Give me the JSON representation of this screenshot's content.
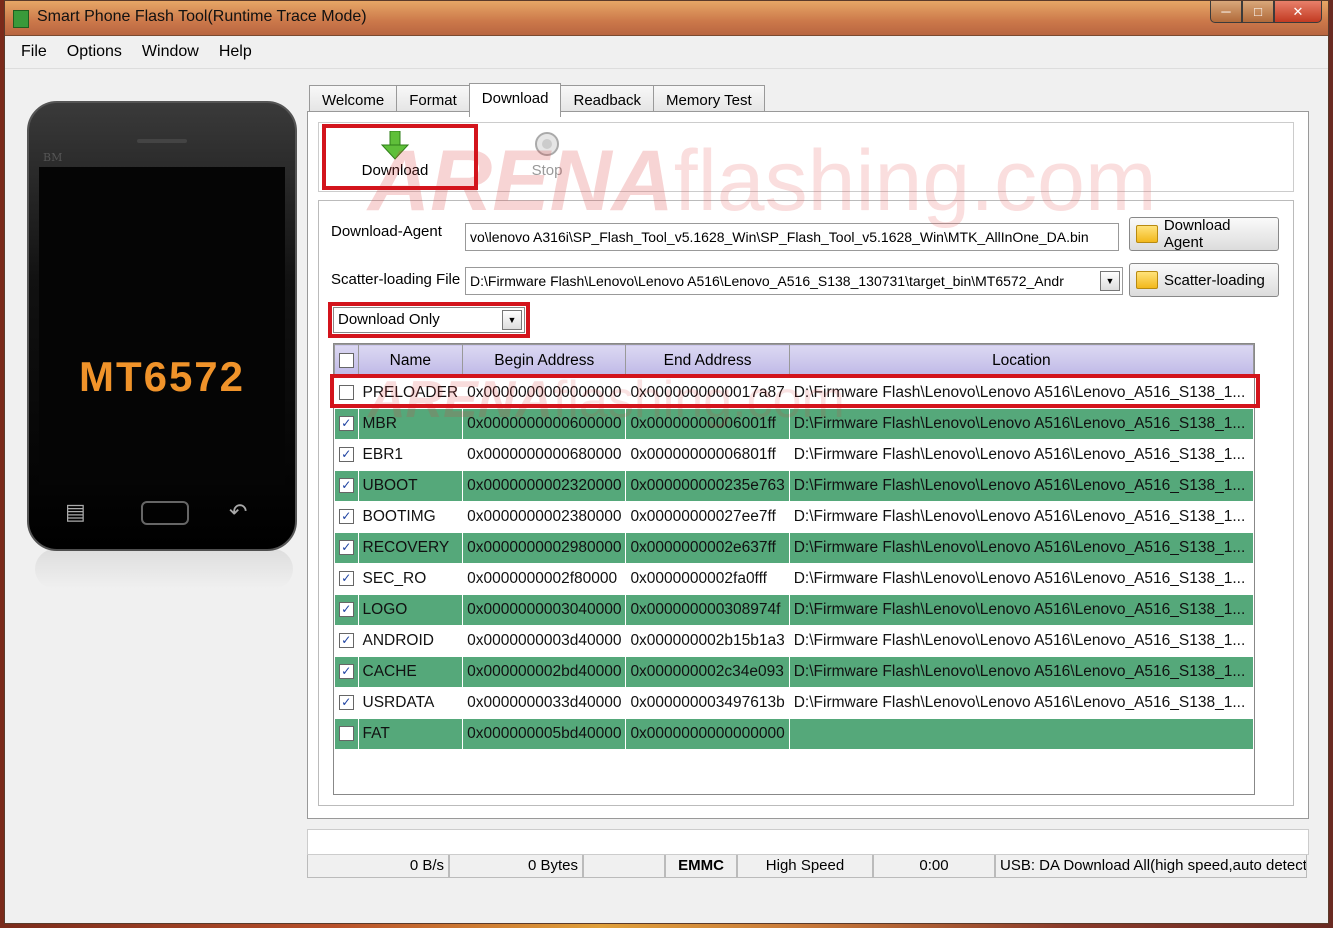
{
  "window": {
    "title": "Smart Phone Flash Tool(Runtime Trace Mode)"
  },
  "menu": [
    "File",
    "Options",
    "Window",
    "Help"
  ],
  "phone": {
    "model": "MT6572",
    "brand": "BM"
  },
  "tabs": [
    "Welcome",
    "Format",
    "Download",
    "Readback",
    "Memory Test"
  ],
  "active_tab": "Download",
  "toolbar": {
    "download_label": "Download",
    "stop_label": "Stop"
  },
  "watermark": {
    "part1": "ARENA",
    "part2": "flashing.com"
  },
  "download_agent": {
    "label": "Download-Agent",
    "value": "vo\\lenovo A316i\\SP_Flash_Tool_v5.1628_Win\\SP_Flash_Tool_v5.1628_Win\\MTK_AllInOne_DA.bin",
    "button": "Download Agent"
  },
  "scatter": {
    "label": "Scatter-loading File",
    "value": "D:\\Firmware Flash\\Lenovo\\Lenovo A516\\Lenovo_A516_S138_130731\\target_bin\\MT6572_Andr",
    "button": "Scatter-loading"
  },
  "mode_select": {
    "value": "Download Only"
  },
  "table": {
    "headers": [
      "Name",
      "Begin Address",
      "End Address",
      "Location"
    ],
    "rows": [
      {
        "checked": false,
        "name": "PRELOADER",
        "begin": "0x0000000000000000",
        "end": "0x0000000000017a87",
        "location": "D:\\Firmware Flash\\Lenovo\\Lenovo A516\\Lenovo_A516_S138_1..."
      },
      {
        "checked": true,
        "name": "MBR",
        "begin": "0x0000000000600000",
        "end": "0x00000000006001ff",
        "location": "D:\\Firmware Flash\\Lenovo\\Lenovo A516\\Lenovo_A516_S138_1..."
      },
      {
        "checked": true,
        "name": "EBR1",
        "begin": "0x0000000000680000",
        "end": "0x00000000006801ff",
        "location": "D:\\Firmware Flash\\Lenovo\\Lenovo A516\\Lenovo_A516_S138_1..."
      },
      {
        "checked": true,
        "name": "UBOOT",
        "begin": "0x0000000002320000",
        "end": "0x000000000235e763",
        "location": "D:\\Firmware Flash\\Lenovo\\Lenovo A516\\Lenovo_A516_S138_1..."
      },
      {
        "checked": true,
        "name": "BOOTIMG",
        "begin": "0x0000000002380000",
        "end": "0x00000000027ee7ff",
        "location": "D:\\Firmware Flash\\Lenovo\\Lenovo A516\\Lenovo_A516_S138_1..."
      },
      {
        "checked": true,
        "name": "RECOVERY",
        "begin": "0x0000000002980000",
        "end": "0x0000000002e637ff",
        "location": "D:\\Firmware Flash\\Lenovo\\Lenovo A516\\Lenovo_A516_S138_1..."
      },
      {
        "checked": true,
        "name": "SEC_RO",
        "begin": "0x0000000002f80000",
        "end": "0x0000000002fa0fff",
        "location": "D:\\Firmware Flash\\Lenovo\\Lenovo A516\\Lenovo_A516_S138_1..."
      },
      {
        "checked": true,
        "name": "LOGO",
        "begin": "0x0000000003040000",
        "end": "0x000000000308974f",
        "location": "D:\\Firmware Flash\\Lenovo\\Lenovo A516\\Lenovo_A516_S138_1..."
      },
      {
        "checked": true,
        "name": "ANDROID",
        "begin": "0x0000000003d40000",
        "end": "0x000000002b15b1a3",
        "location": "D:\\Firmware Flash\\Lenovo\\Lenovo A516\\Lenovo_A516_S138_1..."
      },
      {
        "checked": true,
        "name": "CACHE",
        "begin": "0x000000002bd40000",
        "end": "0x000000002c34e093",
        "location": "D:\\Firmware Flash\\Lenovo\\Lenovo A516\\Lenovo_A516_S138_1..."
      },
      {
        "checked": true,
        "name": "USRDATA",
        "begin": "0x0000000033d40000",
        "end": "0x000000003497613b",
        "location": "D:\\Firmware Flash\\Lenovo\\Lenovo A516\\Lenovo_A516_S138_1..."
      },
      {
        "checked": false,
        "name": "FAT",
        "begin": "0x000000005bd40000",
        "end": "0x0000000000000000",
        "location": ""
      }
    ]
  },
  "status": {
    "speed": "0 B/s",
    "bytes": "0 Bytes",
    "storage": "EMMC",
    "mode": "High Speed",
    "time": "0:00",
    "usb": "USB: DA Download All(high speed,auto detect)"
  },
  "colors": {
    "row_green": "#55a87a",
    "header_lavender": "#bdb7e6",
    "highlight_red": "#d3141c",
    "model_orange": "#f0932a"
  }
}
